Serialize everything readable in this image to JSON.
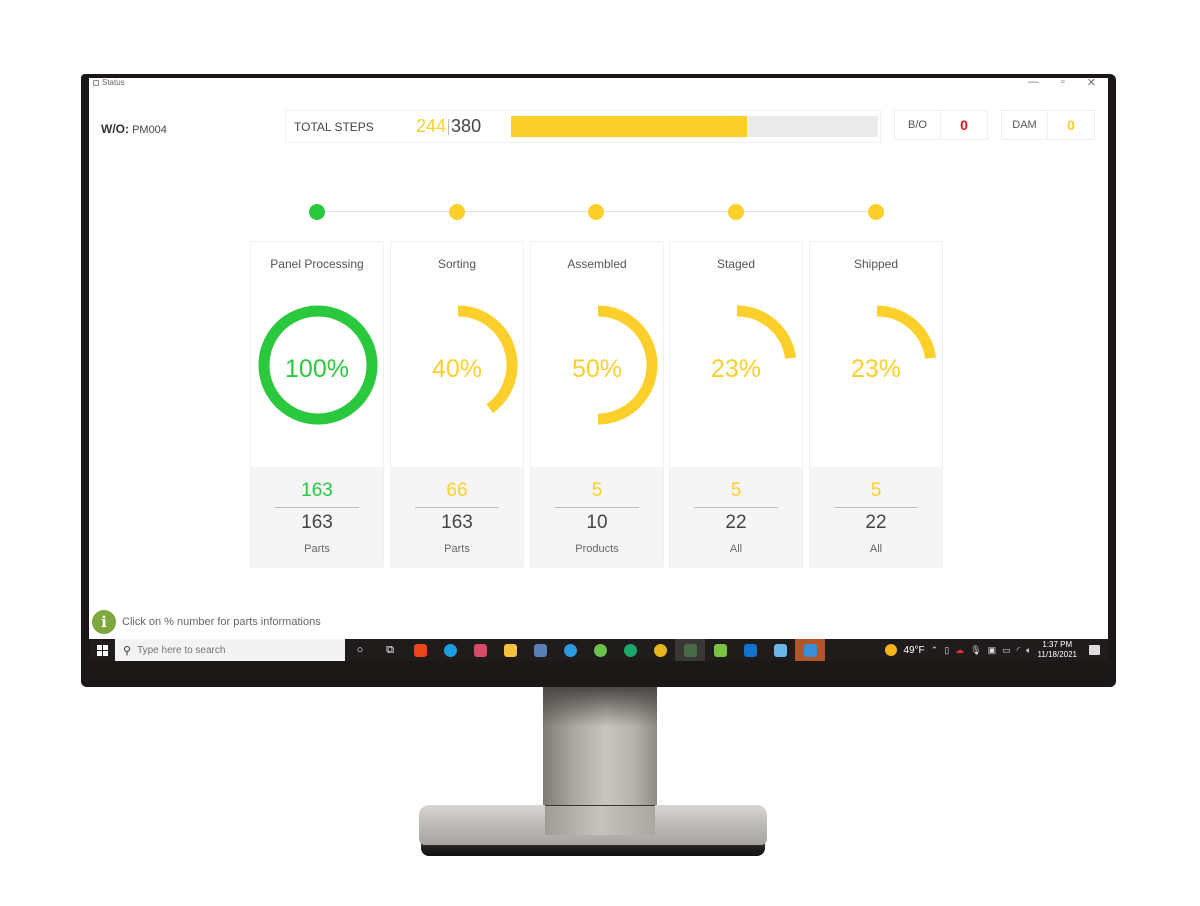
{
  "window": {
    "title": "Status",
    "controls": [
      "—",
      "▫",
      "✕"
    ]
  },
  "header": {
    "wo_label": "W/O:",
    "wo_value": "PM004",
    "total_steps_label": "TOTAL STEPS",
    "steps_done": "244",
    "steps_total": "380",
    "steps_progress_fraction": 0.642,
    "bo_label": "B/O",
    "bo_value": "0",
    "dam_label": "DAM",
    "dam_value": "0"
  },
  "colors": {
    "complete": "#2ac83d",
    "in_progress": "#fccf2b",
    "error": "#e8141b",
    "track": "#ebebeb"
  },
  "stages": [
    {
      "title": "Panel Processing",
      "percent_label": "100%",
      "percent": 100,
      "done": "163",
      "total": "163",
      "unit": "Parts",
      "status": "complete"
    },
    {
      "title": "Sorting",
      "percent_label": "40%",
      "percent": 40,
      "done": "66",
      "total": "163",
      "unit": "Parts",
      "status": "in_progress"
    },
    {
      "title": "Assembled",
      "percent_label": "50%",
      "percent": 50,
      "done": "5",
      "total": "10",
      "unit": "Products",
      "status": "in_progress"
    },
    {
      "title": "Staged",
      "percent_label": "23%",
      "percent": 23,
      "done": "5",
      "total": "22",
      "unit": "All",
      "status": "in_progress"
    },
    {
      "title": "Shipped",
      "percent_label": "23%",
      "percent": 23,
      "done": "5",
      "total": "22",
      "unit": "All",
      "status": "in_progress"
    }
  ],
  "info": {
    "icon": "info-icon",
    "text": "Click on % number for parts informations"
  },
  "taskbar": {
    "search_placeholder": "Type here to search",
    "apps": [
      {
        "name": "cortana-icon",
        "glyph": "○",
        "color": "#ffffff"
      },
      {
        "name": "task-view-icon",
        "glyph": "⧉",
        "color": "#ffffff"
      },
      {
        "name": "office-icon",
        "glyph": "",
        "color": "#e9461b"
      },
      {
        "name": "edge-icon",
        "glyph": "",
        "color": "#1b9de2"
      },
      {
        "name": "paint-icon",
        "glyph": "",
        "color": "#d94a6a"
      },
      {
        "name": "file-explorer-icon",
        "glyph": "",
        "color": "#f4c23e"
      },
      {
        "name": "calculator-icon",
        "glyph": "",
        "color": "#5a7fb5"
      },
      {
        "name": "safari-icon",
        "glyph": "",
        "color": "#2c9bde"
      },
      {
        "name": "database-icon",
        "glyph": "",
        "color": "#6cc24a"
      },
      {
        "name": "target-app-icon",
        "glyph": "",
        "color": "#1ea56b"
      },
      {
        "name": "chrome-icon",
        "glyph": "",
        "color": "#e8b51c"
      },
      {
        "name": "graph-app-icon",
        "glyph": "",
        "color": "#4a6b4a"
      },
      {
        "name": "clock-app-icon",
        "glyph": "",
        "color": "#7cc242"
      },
      {
        "name": "outlook-icon",
        "glyph": "",
        "color": "#1173c9"
      },
      {
        "name": "snowflake-app-icon",
        "glyph": "",
        "color": "#6bb7e8"
      },
      {
        "name": "feedback-app-icon",
        "glyph": "",
        "color": "#3c8ed8"
      }
    ],
    "weather": "49°F",
    "time": "1:37 PM",
    "date": "11/18/2021"
  }
}
